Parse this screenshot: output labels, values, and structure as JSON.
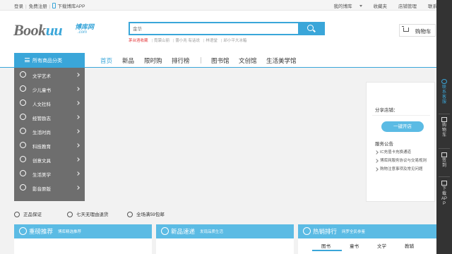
{
  "topbar": {
    "login": "登录",
    "register": "免费注册",
    "download_app": "下载博库APP",
    "my_bookuu": "我的博库",
    "favorites": "收藏夹",
    "store_manage": "店铺管理",
    "contact": "联系客服"
  },
  "header": {
    "logo_text_a": "Book",
    "logo_text_b": "uu",
    "logo_cn": "博库网",
    "logo_com": ".com",
    "search_placeholder": "金华",
    "hot_keywords": [
      "茅台酒收藏",
      "霓裳山丽",
      "蕾小兆 有话说",
      "林语堂",
      "邱小平大冰箱"
    ],
    "cart_label": "购物车"
  },
  "nav": {
    "all_categories": "所有商品分类",
    "items": [
      "首页",
      "新品",
      "限时购",
      "排行榜",
      "图书馆",
      "文创馆",
      "生活美学馆"
    ]
  },
  "categories": [
    {
      "label": "文学艺术",
      "icon": "pencil-icon"
    },
    {
      "label": "少儿童书",
      "icon": "kite-icon"
    },
    {
      "label": "人文社科",
      "icon": "leaf-icon"
    },
    {
      "label": "经管励志",
      "icon": "briefcase-icon"
    },
    {
      "label": "生活时尚",
      "icon": "glasses-icon"
    },
    {
      "label": "科技教育",
      "icon": "cap-icon"
    },
    {
      "label": "创意文具",
      "icon": "box-icon"
    },
    {
      "label": "生活美学",
      "icon": "pot-icon"
    },
    {
      "label": "影音原版",
      "icon": "disc-icon"
    }
  ],
  "sidebox": {
    "share_store": "分享店铺：",
    "open_store": "一键开店",
    "service_title": "服务公告",
    "notices": [
      "IC充值卡充换通道",
      "博库网服务协议与交易规则",
      "购物注意事项及常见问题"
    ]
  },
  "guarantees": [
    "正品保证",
    "七天无理由退货",
    "全场满59包邮"
  ],
  "sections": [
    {
      "title": "重磅推荐",
      "subtitle": "博库精选推荐",
      "icon": "star-icon"
    },
    {
      "title": "新品速递",
      "subtitle": "发现品质生活",
      "icon": "new-icon"
    },
    {
      "title": "热销排行",
      "subtitle": "网罗全民参鉴",
      "icon": "fire-icon",
      "tabs": [
        "图书",
        "童书",
        "文学",
        "教辅"
      ]
    }
  ],
  "dock": {
    "service": "联系客服",
    "cart": "购物车",
    "signin": "签到",
    "download": "下载APP"
  },
  "colors": {
    "accent": "#3aa6d9",
    "section_header": "#5bbbe4",
    "category_bg": "#6e6e6e",
    "dock_bg": "#333333",
    "hot_keyword": "#e4393c"
  }
}
